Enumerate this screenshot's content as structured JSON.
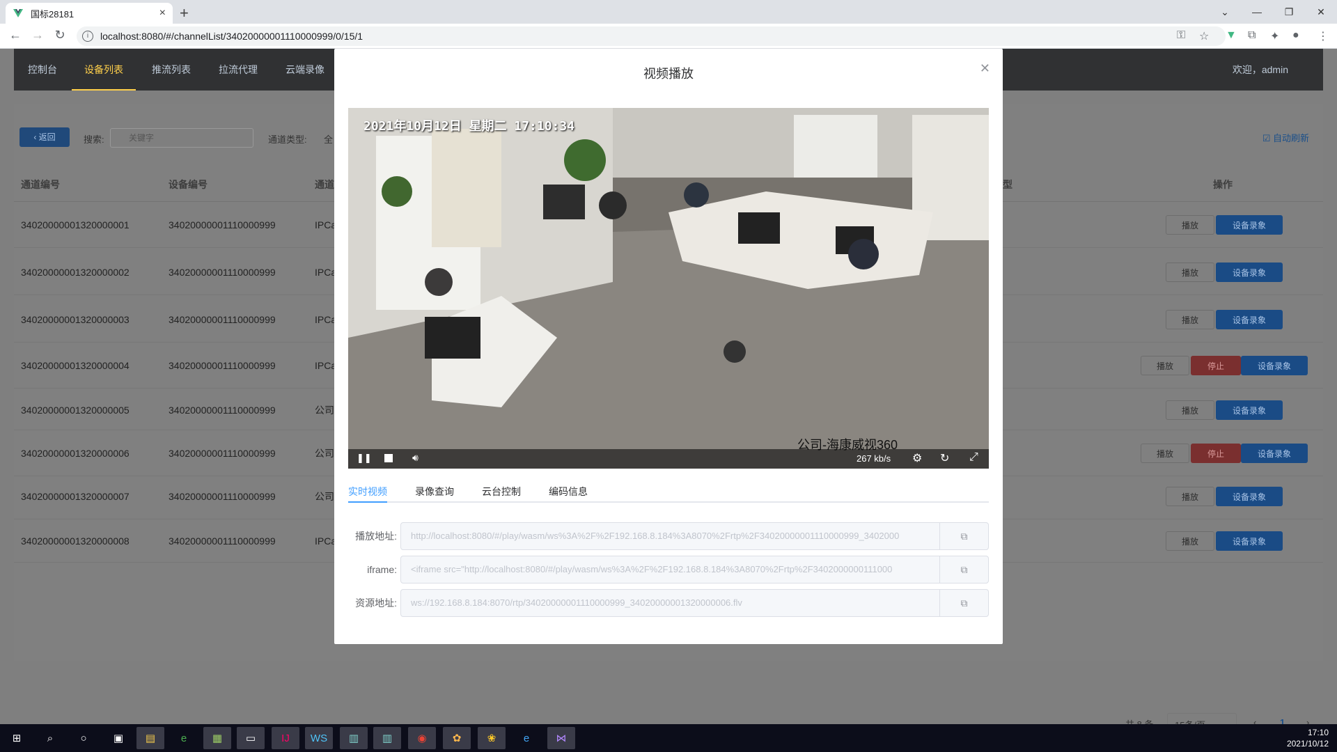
{
  "browser": {
    "tab_title": "国标28181",
    "url": "localhost:8080/#/channelList/34020000001110000999/0/15/1"
  },
  "nav": {
    "items": [
      "控制台",
      "设备列表",
      "推流列表",
      "拉流代理",
      "云端录像"
    ],
    "active": "设备列表",
    "welcome": "欢迎，admin"
  },
  "toolbar": {
    "back": "返回",
    "search_label": "搜索:",
    "search_placeholder": "关键字",
    "channel_type_label": "通道类型:",
    "channel_type_value": "全",
    "auto_refresh": "自动刷新"
  },
  "table": {
    "headers": {
      "channel_id": "通道编号",
      "device_id": "设备编号",
      "channel_name": "通道",
      "type_col": "型",
      "ops": "操作"
    },
    "rows": [
      {
        "channel_id": "34020000001320000001",
        "device_id": "34020000001110000999",
        "name": "IPCa",
        "stop": false
      },
      {
        "channel_id": "34020000001320000002",
        "device_id": "34020000001110000999",
        "name": "IPCa",
        "stop": false
      },
      {
        "channel_id": "34020000001320000003",
        "device_id": "34020000001110000999",
        "name": "IPCa",
        "stop": false
      },
      {
        "channel_id": "34020000001320000004",
        "device_id": "34020000001110000999",
        "name": "IPCa",
        "stop": true
      },
      {
        "channel_id": "34020000001320000005",
        "device_id": "34020000001110000999",
        "name": "公司",
        "stop": false
      },
      {
        "channel_id": "34020000001320000006",
        "device_id": "34020000001110000999",
        "name": "公司",
        "stop": true
      },
      {
        "channel_id": "34020000001320000007",
        "device_id": "34020000001110000999",
        "name": "公司",
        "stop": false
      },
      {
        "channel_id": "34020000001320000008",
        "device_id": "34020000001110000999",
        "name": "IPCa",
        "stop": false
      }
    ],
    "play": "播放",
    "stop": "停止",
    "record": "设备录象"
  },
  "pager": {
    "total": "共 8 条",
    "page_size": "15条/页",
    "current": "1"
  },
  "modal": {
    "title": "视频播放",
    "osd_time": "2021年10月12日 星期二 17:10:34",
    "osd_name": "公司-海康威视360",
    "bitrate": "267 kb/s",
    "tabs": [
      "实时视频",
      "录像查询",
      "云台控制",
      "编码信息"
    ],
    "fields": [
      {
        "label": "播放地址:",
        "value": "http://localhost:8080/#/play/wasm/ws%3A%2F%2F192.168.8.184%3A8070%2Frtp%2F34020000001110000999_3402000"
      },
      {
        "label": "iframe:",
        "value": "<iframe src=\"http://localhost:8080/#/play/wasm/ws%3A%2F%2F192.168.8.184%3A8070%2Frtp%2F3402000000111000"
      },
      {
        "label": "资源地址:",
        "value": "ws://192.168.8.184:8070/rtp/34020000001110000999_34020000001320000006.flv"
      }
    ]
  },
  "clock": {
    "time": "17:10",
    "date": "2021/10/12"
  }
}
